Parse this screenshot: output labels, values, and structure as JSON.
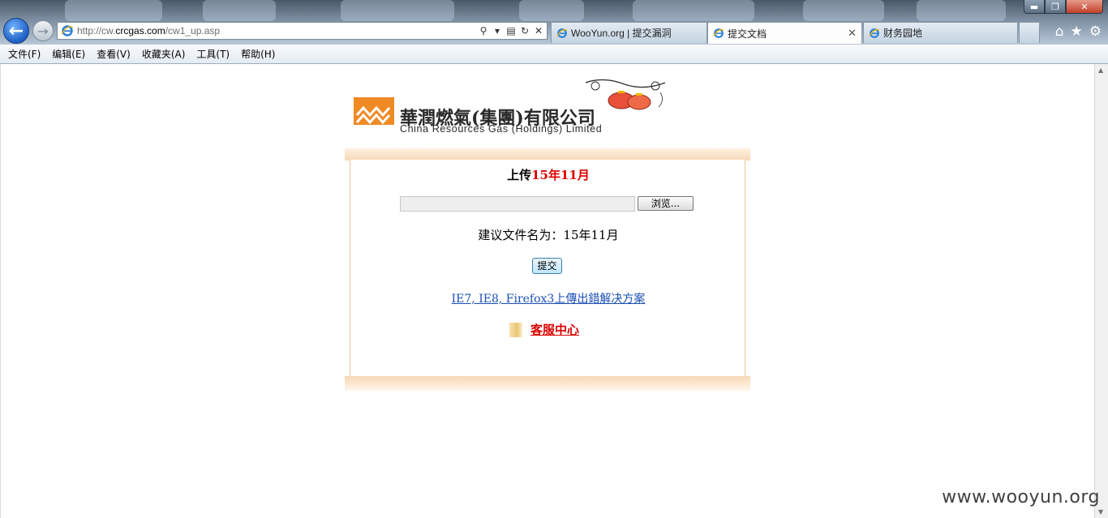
{
  "browser": {
    "address_url_prefix": "http://cw.",
    "address_url_domain": "crcgas.com",
    "address_url_path": "/cw1_up.asp",
    "tabs": [
      {
        "label": "WooYun.org | 提交漏洞"
      },
      {
        "label": "提交文档"
      },
      {
        "label": "财务园地"
      }
    ],
    "window_buttons": {
      "minimize": "▬",
      "maximize": "❐",
      "close": "✕"
    }
  },
  "menu": {
    "items": [
      "文件(F)",
      "编辑(E)",
      "查看(V)",
      "收藏夹(A)",
      "工具(T)",
      "帮助(H)"
    ]
  },
  "page": {
    "logo_cn": "華潤燃氣(集團)有限公司",
    "logo_en": "China Resources Gas (Holdings) Limited",
    "title_prefix": "上传",
    "title_period": "15年11月",
    "browse_label": "浏览...",
    "suggest_text": "建议文件名为：15年11月",
    "submit_label": "提交",
    "help_link": "IE7, IE8, Firefox3上傳出錯解决方案",
    "service_link": "客服中心"
  },
  "watermark": "www.wooyun.org",
  "colors": {
    "accent_red": "#dd0000",
    "logo_orange": "#f08a24",
    "panel_border": "#f1c49a",
    "link_blue": "#1a4fb4"
  },
  "icons": {
    "back": "back-arrow-icon",
    "forward": "forward-arrow-icon",
    "ie": "ie-icon",
    "home": "home-icon",
    "favorites": "star-icon",
    "settings": "gear-icon"
  }
}
